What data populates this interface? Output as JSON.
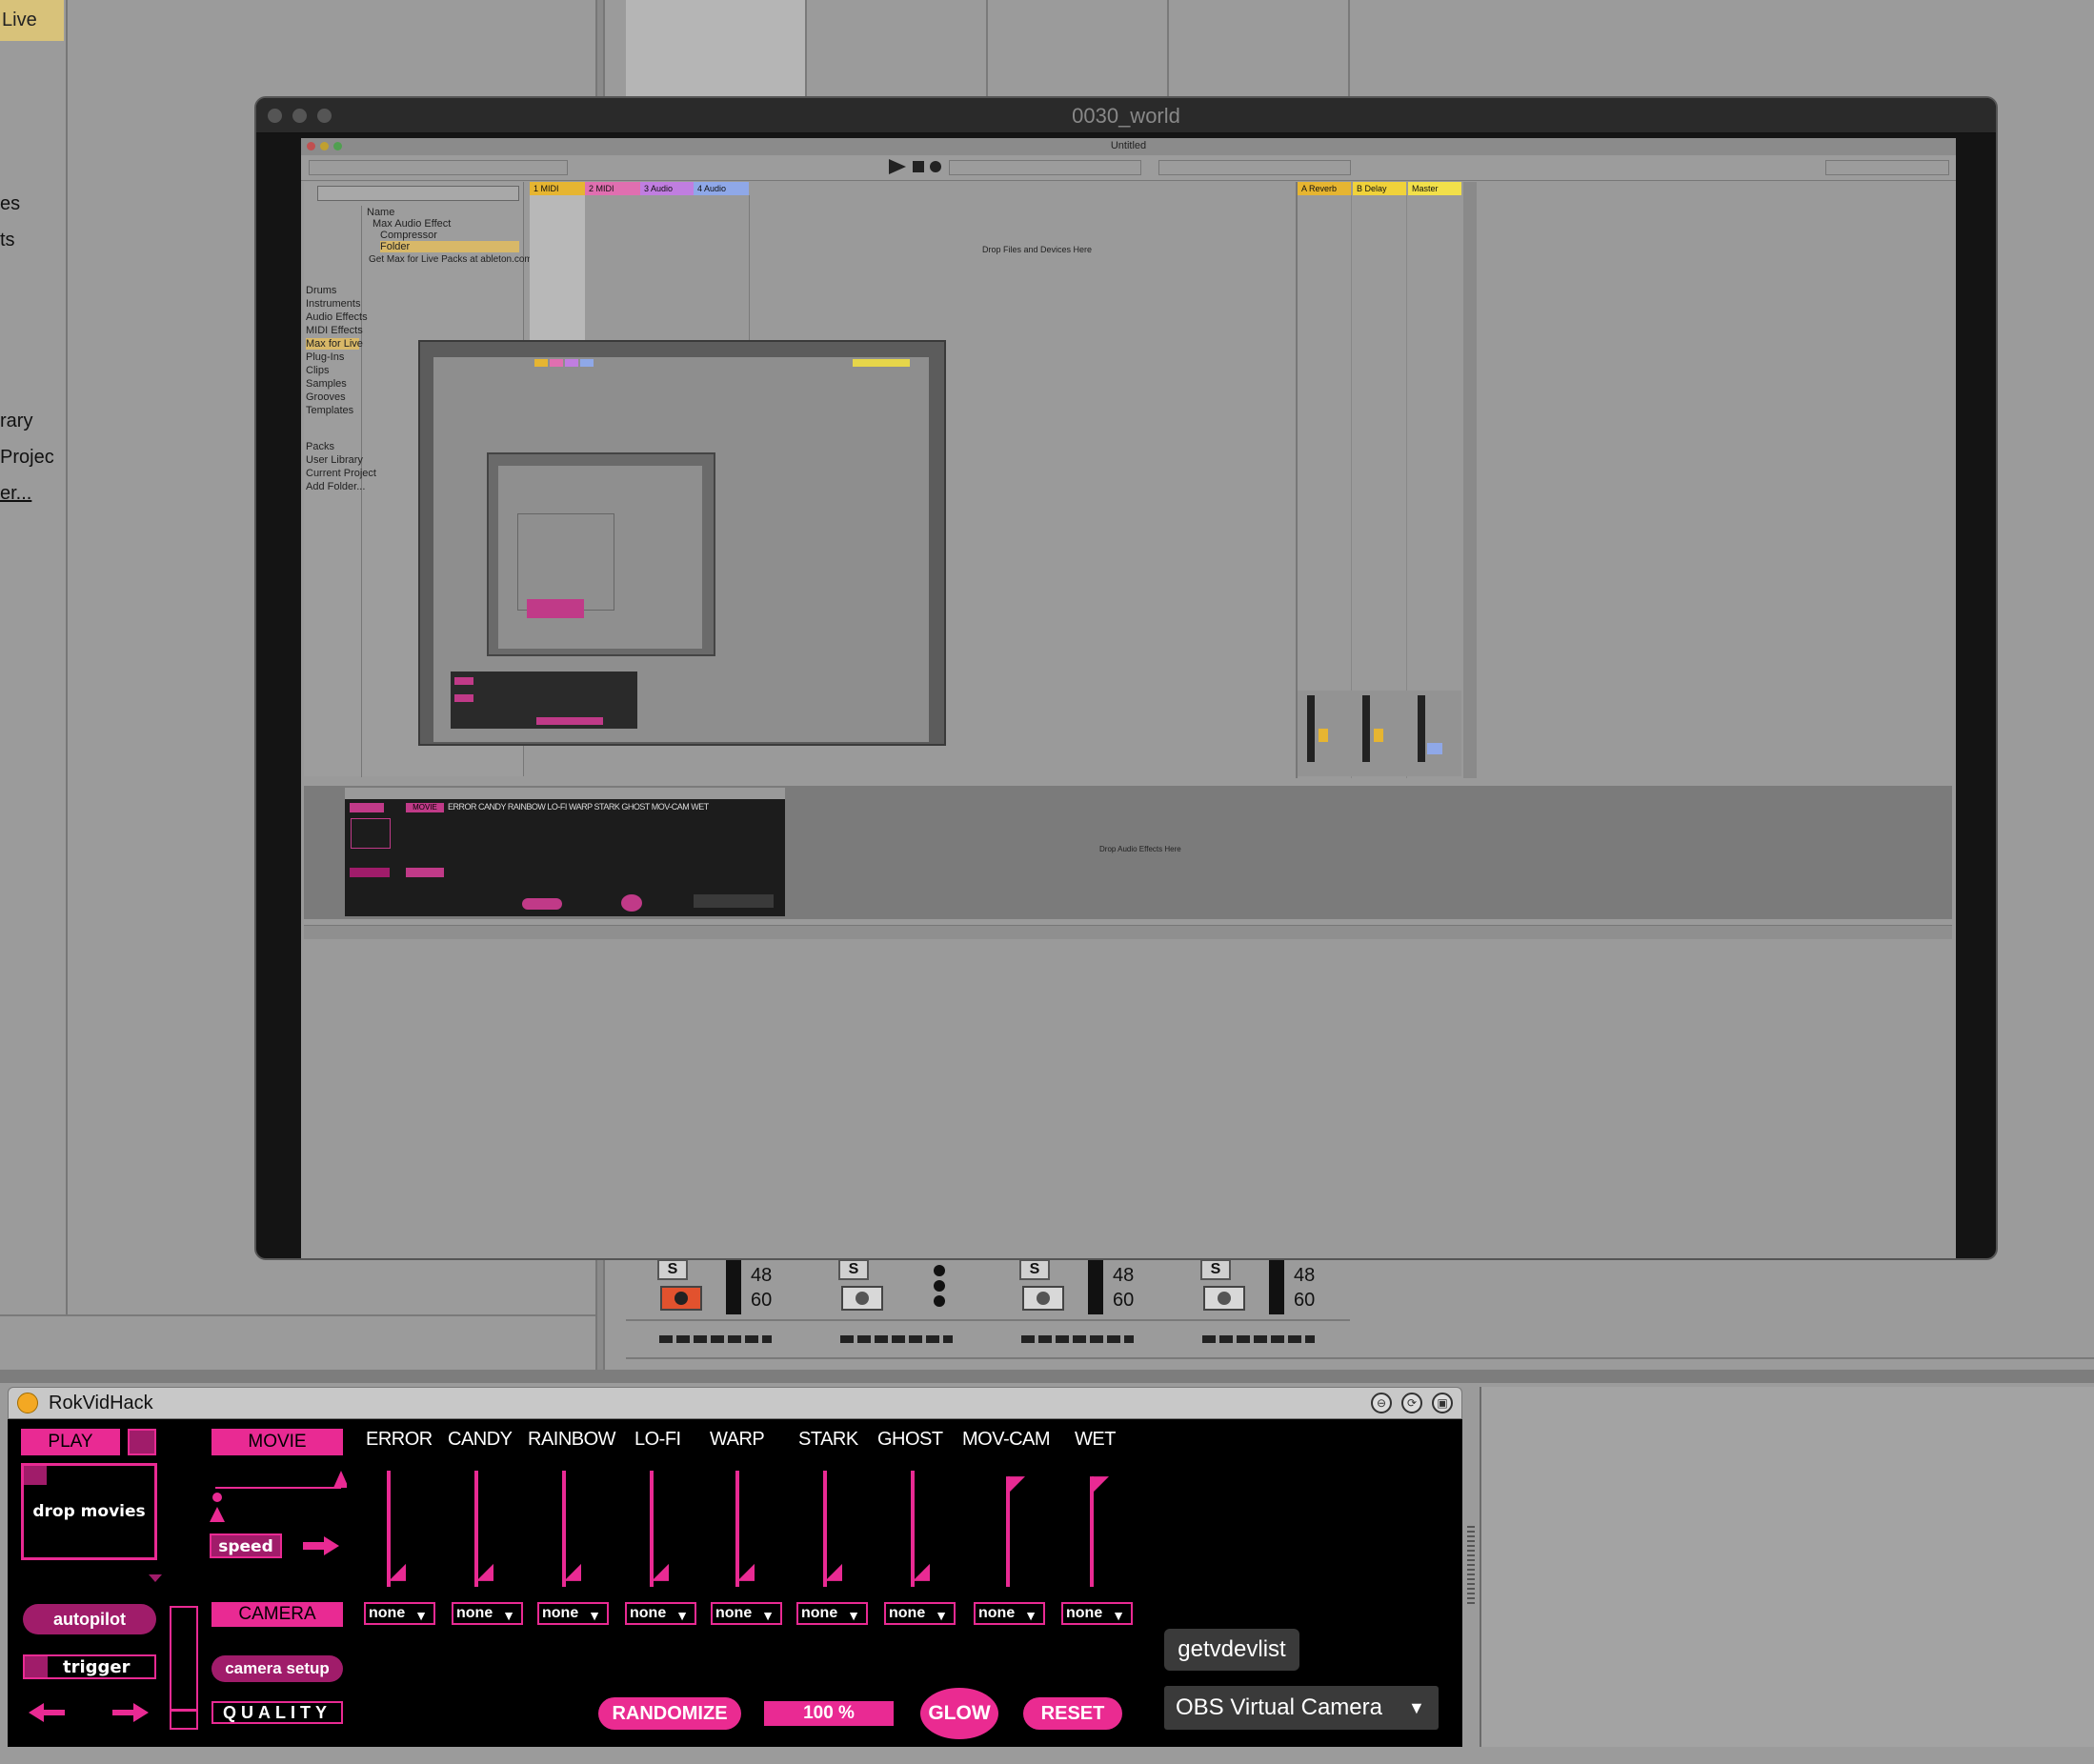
{
  "background": {
    "live_tab": "Live",
    "sidebar_fragments": [
      "es",
      "ts",
      "rary",
      "Projec",
      "er..."
    ],
    "meters": [
      {
        "s_label": "S",
        "rec_active": true,
        "scale": [
          "48",
          "60"
        ]
      },
      {
        "s_label": "S",
        "rec_active": false,
        "scale": []
      },
      {
        "s_label": "S",
        "rec_active": false,
        "scale": [
          "48",
          "60"
        ]
      },
      {
        "s_label": "S",
        "rec_active": false,
        "scale": [
          "48",
          "60"
        ]
      }
    ]
  },
  "obs_window": {
    "title": "0030_world",
    "inner_title": "Untitled",
    "clip_tracks": [
      {
        "name": "1 MIDI",
        "color": "#e6b531"
      },
      {
        "name": "2 MIDI",
        "color": "#e06fb0"
      },
      {
        "name": "3 Audio",
        "color": "#c07ee0"
      },
      {
        "name": "4 Audio",
        "color": "#8fa8e8"
      }
    ],
    "return_tracks": [
      {
        "name": "A Reverb",
        "color": "#e6b531"
      },
      {
        "name": "B Delay",
        "color": "#f0d23a"
      },
      {
        "name": "Master",
        "color": "#f2e04a"
      }
    ],
    "drop_hint": "Drop Files and Devices Here",
    "browser_items": [
      "Drums",
      "Instruments",
      "Audio Effects",
      "MIDI Effects",
      "Max for Live",
      "Plug-Ins",
      "Clips",
      "Samples",
      "Grooves",
      "Templates"
    ],
    "browser_places": [
      "Packs",
      "User Library",
      "Current Project",
      "Add Folder..."
    ],
    "browser_content": [
      "Name",
      "Max Audio Effect",
      "Compressor",
      "Folder",
      "Get Max for Live Packs at ableton.com"
    ],
    "device_drop_hint": "Drop Audio Effects Here",
    "mini_device_labels": [
      "MOVIE",
      "ERROR",
      "CANDY",
      "RAINBOW",
      "LO-FI",
      "WARP",
      "STARK",
      "GHOST",
      "MOV-CAM",
      "WET"
    ]
  },
  "device": {
    "title": "RokVidHack",
    "play_label": "PLAY",
    "drop_label": "drop movies",
    "movie_label": "MOVIE",
    "speed_label": "speed",
    "camera_label": "CAMERA",
    "camera_setup_label": "camera setup",
    "quality_label": "QUALITY",
    "autopilot_label": "autopilot",
    "trigger_label": "trigger",
    "effects": [
      {
        "name": "ERROR",
        "value": 0.05,
        "dropdown": "none"
      },
      {
        "name": "CANDY",
        "value": 0.05,
        "dropdown": "none"
      },
      {
        "name": "RAINBOW",
        "value": 0.05,
        "dropdown": "none"
      },
      {
        "name": "LO-FI",
        "value": 0.05,
        "dropdown": "none"
      },
      {
        "name": "WARP",
        "value": 0.05,
        "dropdown": "none"
      },
      {
        "name": "STARK",
        "value": 0.05,
        "dropdown": "none"
      },
      {
        "name": "GHOST",
        "value": 0.05,
        "dropdown": "none"
      },
      {
        "name": "MOV-CAM",
        "value": 0.95,
        "dropdown": "none"
      },
      {
        "name": "WET",
        "value": 0.95,
        "dropdown": "none"
      }
    ],
    "randomize_label": "RANDOMIZE",
    "percent_label": "100 %",
    "glow_label": "GLOW",
    "reset_label": "RESET",
    "getvdevlist_label": "getvdevlist",
    "camera_device": "OBS Virtual Camera",
    "accent_color": "#e92a93"
  }
}
